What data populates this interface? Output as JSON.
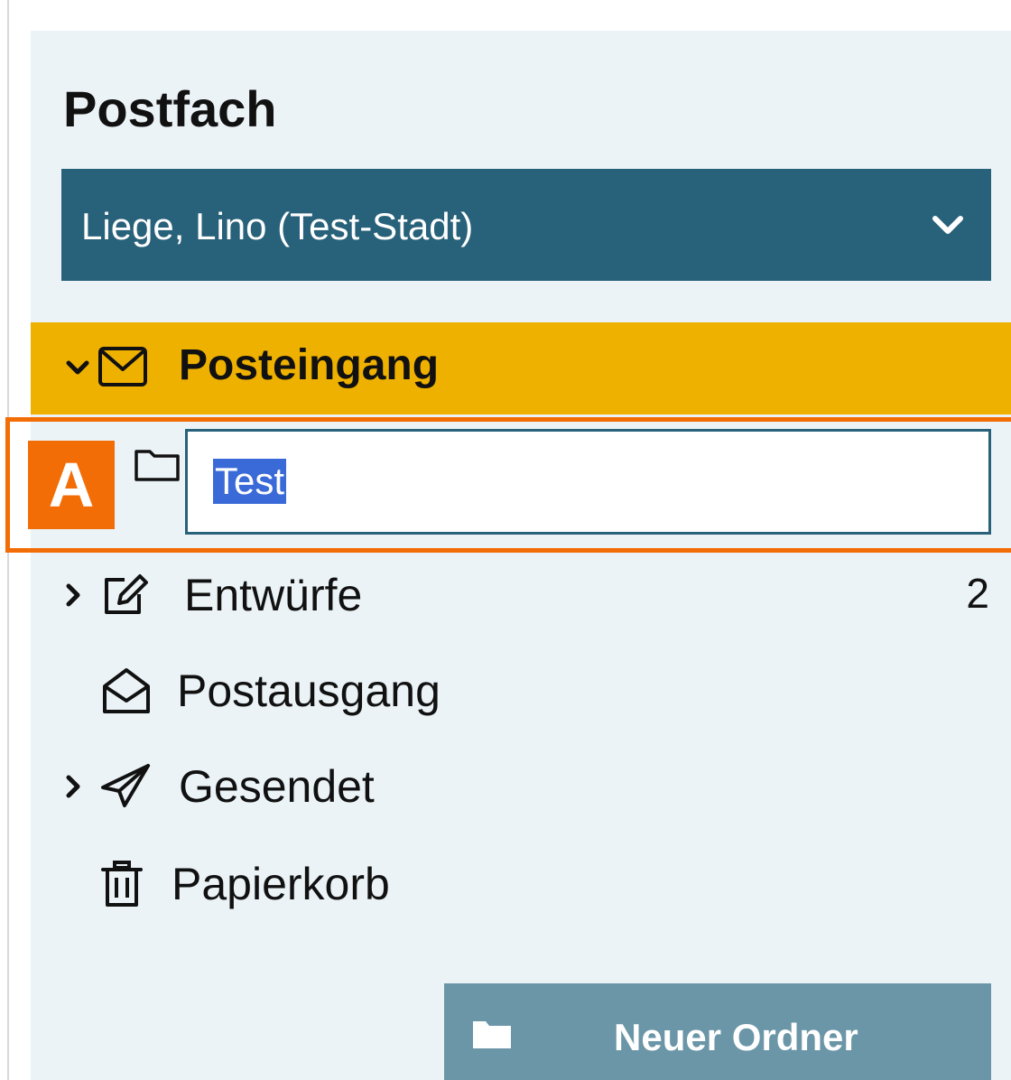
{
  "sidebar": {
    "title": "Postfach",
    "mailbox_select": {
      "value": "Liege, Lino (Test-Stadt)",
      "icon": "chevron-down-icon"
    },
    "folders": {
      "inbox": {
        "label": "Posteingang",
        "selected": true,
        "highlight_color": "#efb100"
      },
      "rename": {
        "value": "Test",
        "icon": "folder-icon"
      },
      "drafts": {
        "label": "Entwürfe",
        "count": "2"
      },
      "outbox": {
        "label": "Postausgang"
      },
      "sent": {
        "label": "Gesendet"
      },
      "trash": {
        "label": "Papierkorb"
      }
    },
    "new_folder_button": {
      "label": "Neuer Ordner"
    }
  },
  "annotation": {
    "label": "A",
    "color": "#f36d07"
  },
  "colors": {
    "primary": "#28617a",
    "panel_bg": "#ebf3f7",
    "button_disabled": "#6b96a8"
  }
}
